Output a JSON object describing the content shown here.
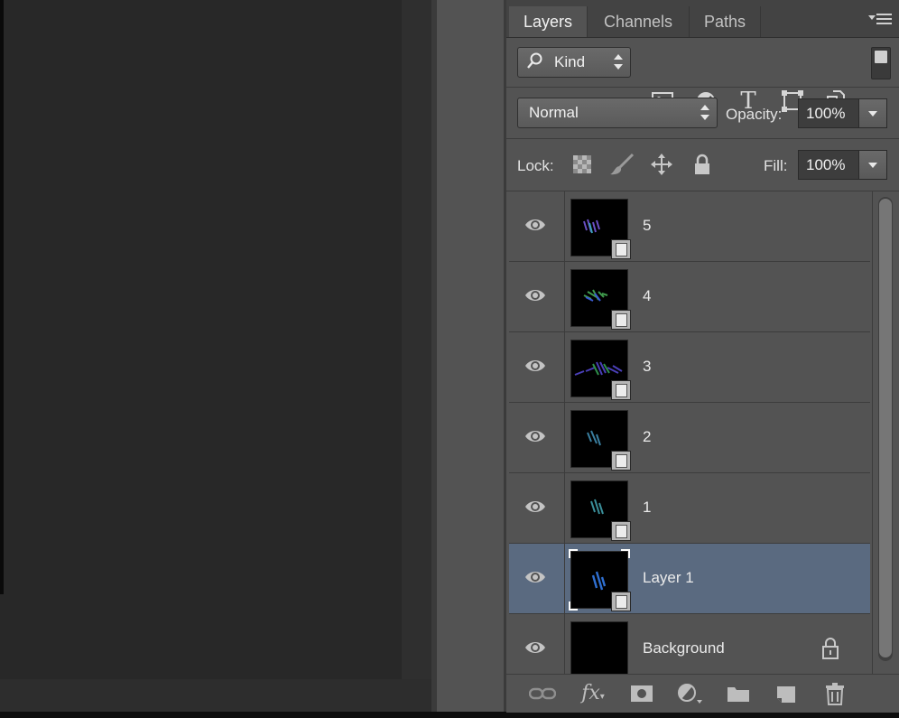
{
  "tabs": [
    {
      "label": "Layers",
      "active": true
    },
    {
      "label": "Channels",
      "active": false
    },
    {
      "label": "Paths",
      "active": false
    }
  ],
  "filter": {
    "kind_label": "Kind",
    "icons": [
      "pixel-layer-filter-icon",
      "adjustment-layer-filter-icon",
      "type-layer-filter-icon",
      "shape-layer-filter-icon",
      "smart-object-filter-icon"
    ]
  },
  "blend": {
    "mode": "Normal",
    "opacity_label": "Opacity:",
    "opacity_value": "100%"
  },
  "lock": {
    "label": "Lock:",
    "fill_label": "Fill:",
    "fill_value": "100%"
  },
  "layers": [
    {
      "name": "5",
      "selected": false,
      "visible": true,
      "smart_object": true
    },
    {
      "name": "4",
      "selected": false,
      "visible": true,
      "smart_object": true
    },
    {
      "name": "3",
      "selected": false,
      "visible": true,
      "smart_object": true
    },
    {
      "name": "2",
      "selected": false,
      "visible": true,
      "smart_object": true
    },
    {
      "name": "1",
      "selected": false,
      "visible": true,
      "smart_object": true
    },
    {
      "name": "Layer 1",
      "selected": true,
      "visible": true,
      "smart_object": true
    },
    {
      "name": "Background",
      "selected": false,
      "visible": true,
      "smart_object": false,
      "locked": true
    }
  ],
  "footer_icons": [
    "link-layers-icon",
    "fx-icon",
    "layer-mask-icon",
    "adjustment-layer-icon",
    "group-folder-icon",
    "new-layer-icon",
    "trash-icon"
  ],
  "colors": {
    "panel_bg": "#535353",
    "selected_row": "#5a6a80",
    "canvas_bg": "#282828"
  }
}
